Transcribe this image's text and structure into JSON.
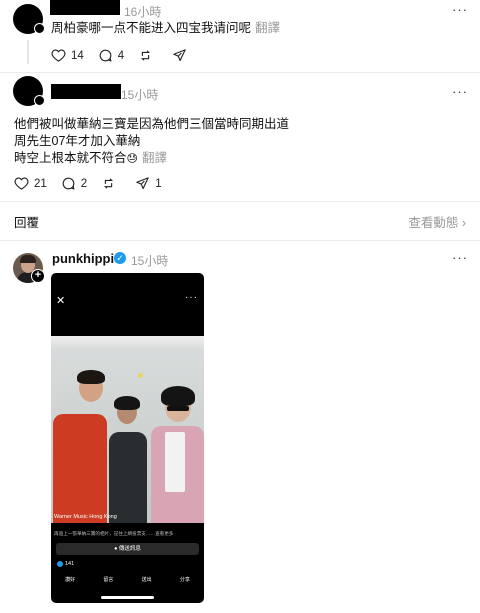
{
  "comment1": {
    "time": "16小時",
    "text": "周柏豪哪一点不能进入四宝我请问呢",
    "translate": "翻譯",
    "likes": "14",
    "replies": "4"
  },
  "comment2": {
    "time": "15小時",
    "lines": [
      "他們被叫做華納三寶是因為他們三個當時同期出道",
      "周先生07年才加入華納",
      "時空上根本就不符合"
    ],
    "emoji": "😓",
    "translate": "翻譯",
    "likes": "21",
    "replies": "2",
    "shares": "1"
  },
  "reply_section": {
    "label": "回覆",
    "view_activity": "查看動態",
    "chevron": "›"
  },
  "post": {
    "username": "punkhippie",
    "time": "15小時",
    "more": "···",
    "embedded": {
      "close": "✕",
      "more": "···",
      "caption_title": "Warner Music Hong Kong",
      "caption_sub": "再過上一張華納三寶的相片，記住上網投票支……查看更多",
      "message_button": "傳送訊息",
      "likes": "141",
      "actions": [
        "讚好",
        "留言",
        "送出",
        "分享"
      ]
    }
  },
  "icons": {
    "heart": "heart-icon",
    "comment": "comment-icon",
    "repost": "repost-icon",
    "share": "send-icon",
    "more": "more-icon",
    "verified": "verified-icon"
  },
  "colors": {
    "accent": "#1d9bf0",
    "muted": "#999999"
  }
}
